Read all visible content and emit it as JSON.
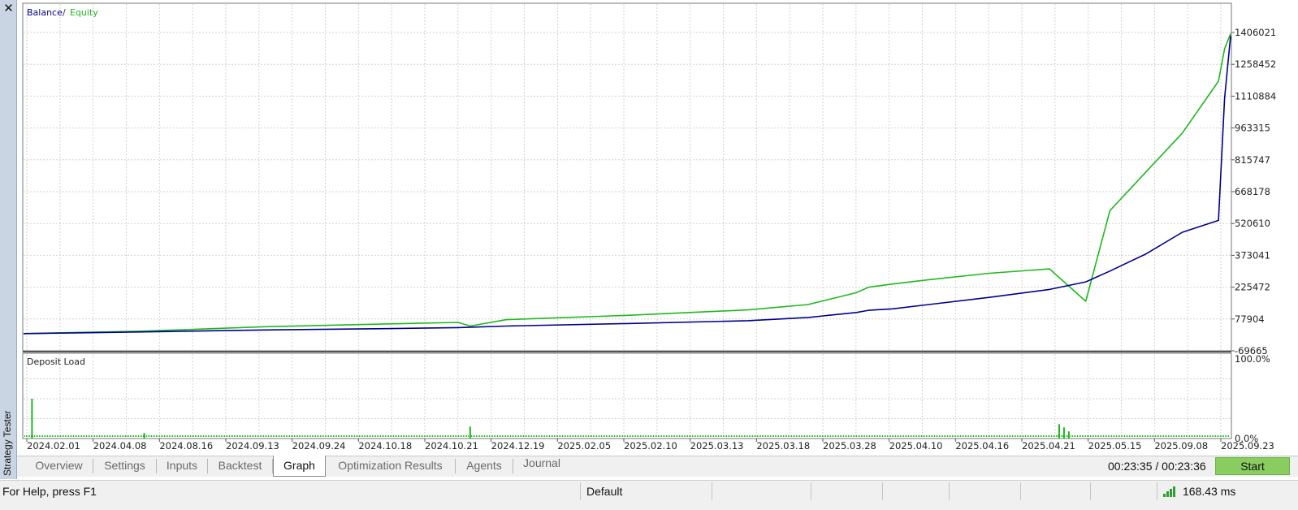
{
  "window": {
    "vertical_title": "Strategy Tester"
  },
  "chart_data": [
    {
      "type": "line",
      "legend": [
        "Balance",
        "Equity"
      ],
      "legend_placement": "top-left",
      "y_ticks": [
        "1406021",
        "1258452",
        "1110884",
        "963315",
        "815747",
        "668178",
        "520610",
        "373041",
        "225472",
        "77904",
        "-69665"
      ],
      "ylim": [
        -69665,
        1406021
      ],
      "grid": true,
      "x_ticks": [
        "2024.02.01",
        "2024.04.08",
        "2024.08.16",
        "2024.09.13",
        "2024.09.24",
        "2024.10.18",
        "2024.10.21",
        "2024.12.19",
        "2025.02.05",
        "2025.02.10",
        "2025.03.13",
        "2025.03.18",
        "2025.03.28",
        "2025.04.10",
        "2025.04.16",
        "2025.04.21",
        "2025.05.15",
        "2025.09.08",
        "2025.09.23"
      ],
      "x": [
        0,
        0.1,
        0.2,
        0.3,
        0.36,
        0.37,
        0.4,
        0.5,
        0.6,
        0.65,
        0.69,
        0.7,
        0.72,
        0.75,
        0.8,
        0.85,
        0.88,
        0.9,
        0.93,
        0.96,
        0.99,
        0.995,
        1.0
      ],
      "series": [
        {
          "name": "Balance",
          "color": "#00008b",
          "values": [
            10000,
            18000,
            27000,
            33000,
            38000,
            40000,
            45000,
            57000,
            70000,
            85000,
            108000,
            118000,
            125000,
            145000,
            178000,
            215000,
            250000,
            300000,
            380000,
            480000,
            535000,
            1100000,
            1390000
          ]
        },
        {
          "name": "Equity",
          "color": "#1fb81f",
          "values": [
            10000,
            22000,
            42000,
            55000,
            62000,
            45000,
            75000,
            95000,
            120000,
            145000,
            200000,
            225000,
            240000,
            260000,
            290000,
            310000,
            160000,
            580000,
            760000,
            940000,
            1180000,
            1330000,
            1400000
          ]
        }
      ]
    },
    {
      "type": "bar",
      "title": "Deposit Load",
      "y_ticks": [
        "100.0%",
        "0.0%"
      ],
      "ylim": [
        0,
        100
      ],
      "x": [
        0.007,
        0.1,
        0.37,
        0.858,
        0.862,
        0.866
      ],
      "values": [
        50,
        7,
        15,
        18,
        14,
        9
      ],
      "baseline": 3,
      "color": "#1fb81f"
    }
  ],
  "tabs": [
    {
      "label": "Overview",
      "active": false
    },
    {
      "label": "Settings",
      "active": false
    },
    {
      "label": "Inputs",
      "active": false
    },
    {
      "label": "Backtest",
      "active": false
    },
    {
      "label": "Graph",
      "active": true
    },
    {
      "label": "Optimization Results",
      "active": false
    },
    {
      "label": "Agents",
      "active": false
    },
    {
      "label": "Journal",
      "active": false
    }
  ],
  "timer": "00:23:35 / 00:23:36",
  "start_label": "Start",
  "status": {
    "help": "For Help, press F1",
    "profile": "Default",
    "ping": "168.43 ms"
  }
}
